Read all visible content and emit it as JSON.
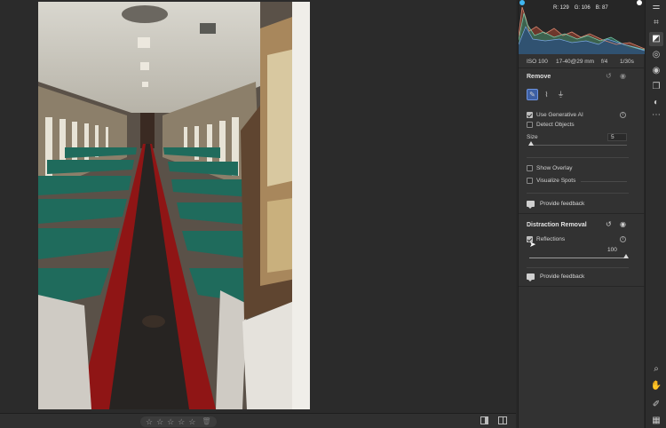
{
  "histogram": {
    "readout": {
      "r": "R: 129",
      "g": "G: 106",
      "b": "B: 87"
    }
  },
  "camera_info": {
    "iso": "ISO 100",
    "focal": "17-40@29 mm",
    "aperture": "f/4",
    "shutter": "1/30s"
  },
  "remove": {
    "title": "Remove",
    "tools": [
      "brush-remove-icon",
      "bandage-heal-icon",
      "clone-stamp-icon"
    ],
    "use_generative_ai": {
      "label": "Use Generative AI",
      "checked": true
    },
    "detect_objects": {
      "label": "Detect Objects",
      "checked": false
    },
    "size": {
      "label": "Size",
      "value": "5"
    },
    "show_overlay": {
      "label": "Show Overlay",
      "checked": false
    },
    "visualize_spots": {
      "label": "Visualize Spots",
      "checked": false
    },
    "feedback": "Provide feedback"
  },
  "distraction": {
    "title": "Distraction Removal",
    "reflections": {
      "label": "Reflections",
      "checked": true,
      "value": "100"
    },
    "feedback": "Provide feedback"
  },
  "filmstrip": {
    "stars": [
      "☆",
      "☆",
      "☆",
      "☆",
      "☆"
    ],
    "trash": "🗑"
  },
  "colors": {
    "panel_bg": "#323232",
    "accent": "#3d5fa3",
    "canvas_bg": "#2b2b2b"
  }
}
